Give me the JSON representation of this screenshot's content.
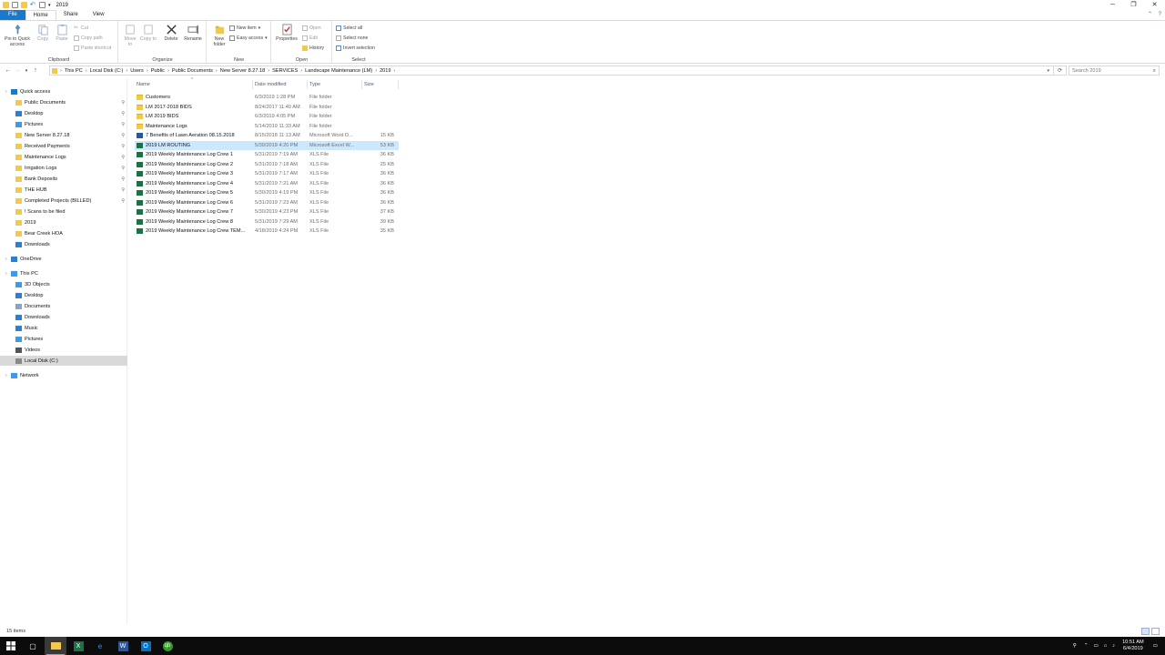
{
  "window": {
    "title": "2019"
  },
  "ribbon": {
    "tabs": [
      {
        "label": "File"
      },
      {
        "label": "Home"
      },
      {
        "label": "Share"
      },
      {
        "label": "View"
      }
    ],
    "clipboard": {
      "label": "Clipboard",
      "pin": "Pin to Quick access",
      "copy": "Copy",
      "paste": "Paste",
      "cut": "Cut",
      "copy_path": "Copy path",
      "paste_shortcut": "Paste shortcut"
    },
    "organize": {
      "label": "Organize",
      "move_to": "Move to",
      "copy_to": "Copy to",
      "delete": "Delete",
      "rename": "Rename"
    },
    "new": {
      "label": "New",
      "new_folder": "New folder",
      "new_item": "New item",
      "easy_access": "Easy access"
    },
    "open": {
      "label": "Open",
      "properties": "Properties",
      "open": "Open",
      "edit": "Edit",
      "history": "History"
    },
    "select": {
      "label": "Select",
      "select_all": "Select all",
      "select_none": "Select none",
      "invert": "Invert selection"
    }
  },
  "address": {
    "crumbs": [
      "This PC",
      "Local Disk (C:)",
      "Users",
      "Public",
      "Public Documents",
      "New Server 8.27.18",
      "SERVICES",
      "Landscape Maintenance (LM)",
      "2019"
    ],
    "search_placeholder": "Search 2019"
  },
  "nav": {
    "quick_access": {
      "label": "Quick access",
      "items": [
        {
          "label": "Public Documents",
          "pinned": true
        },
        {
          "label": "Desktop",
          "pinned": true
        },
        {
          "label": "Pictures",
          "pinned": true
        },
        {
          "label": "New Server 8.27.18",
          "pinned": true
        },
        {
          "label": "Received Payments",
          "pinned": true
        },
        {
          "label": "Maintenance Logs",
          "pinned": true
        },
        {
          "label": "Irrigation Logs",
          "pinned": true
        },
        {
          "label": "Bank Deposits",
          "pinned": true
        },
        {
          "label": "THE HUB",
          "pinned": true
        },
        {
          "label": "Completed Projects (BILLED)",
          "pinned": true
        },
        {
          "label": "! Scans to be filed",
          "pinned": false
        },
        {
          "label": "2019",
          "pinned": false
        },
        {
          "label": "Bear Creek HOA",
          "pinned": false
        },
        {
          "label": "Downloads",
          "pinned": false
        }
      ]
    },
    "onedrive": "OneDrive",
    "this_pc": {
      "label": "This PC",
      "items": [
        {
          "label": "3D Objects"
        },
        {
          "label": "Desktop"
        },
        {
          "label": "Documents"
        },
        {
          "label": "Downloads"
        },
        {
          "label": "Music"
        },
        {
          "label": "Pictures"
        },
        {
          "label": "Videos"
        },
        {
          "label": "Local Disk (C:)"
        }
      ]
    },
    "network": "Network"
  },
  "columns": {
    "name": "Name",
    "date": "Date modified",
    "type": "Type",
    "size": "Size"
  },
  "files": [
    {
      "name": "Customers",
      "date": "6/3/2019 1:28 PM",
      "type": "File folder",
      "size": "",
      "kind": "folder"
    },
    {
      "name": "LM 2017-2018 BIDS",
      "date": "8/24/2017 11:40 AM",
      "type": "File folder",
      "size": "",
      "kind": "folder"
    },
    {
      "name": "LM 2019 BIDS",
      "date": "6/3/2019 4:05 PM",
      "type": "File folder",
      "size": "",
      "kind": "folder"
    },
    {
      "name": "Maintenance Logs",
      "date": "5/14/2019 11:33 AM",
      "type": "File folder",
      "size": "",
      "kind": "folder"
    },
    {
      "name": "7 Benefits of Lawn Aeration 08.15.2018",
      "date": "8/15/2018 11:13 AM",
      "type": "Microsoft Word D...",
      "size": "15 KB",
      "kind": "word"
    },
    {
      "name": "2019 LM ROUTING",
      "date": "5/30/2019 4:20 PM",
      "type": "Microsoft Excel W...",
      "size": "53 KB",
      "kind": "xls"
    },
    {
      "name": "2019 Weekly Maintenance Log Crew 1",
      "date": "5/31/2019 7:19 AM",
      "type": "XLS File",
      "size": "36 KB",
      "kind": "xls"
    },
    {
      "name": "2019 Weekly Maintenance Log Crew 2",
      "date": "5/31/2019 7:18 AM",
      "type": "XLS File",
      "size": "25 KB",
      "kind": "xls"
    },
    {
      "name": "2019 Weekly Maintenance Log Crew 3",
      "date": "5/31/2019 7:17 AM",
      "type": "XLS File",
      "size": "36 KB",
      "kind": "xls"
    },
    {
      "name": "2019 Weekly Maintenance Log Crew 4",
      "date": "5/31/2019 7:21 AM",
      "type": "XLS File",
      "size": "36 KB",
      "kind": "xls"
    },
    {
      "name": "2019 Weekly Maintenance Log Crew 5",
      "date": "5/30/2019 4:19 PM",
      "type": "XLS File",
      "size": "36 KB",
      "kind": "xls"
    },
    {
      "name": "2019 Weekly Maintenance Log Crew 6",
      "date": "5/31/2019 7:23 AM",
      "type": "XLS File",
      "size": "36 KB",
      "kind": "xls"
    },
    {
      "name": "2019 Weekly Maintenance Log Crew 7",
      "date": "5/30/2019 4:23 PM",
      "type": "XLS File",
      "size": "37 KB",
      "kind": "xls"
    },
    {
      "name": "2019 Weekly Maintenance Log Crew 8",
      "date": "5/31/2019 7:29 AM",
      "type": "XLS File",
      "size": "39 KB",
      "kind": "xls"
    },
    {
      "name": "2019 Weekly Maintenance Log Crew TEM...",
      "date": "4/18/2019 4:24 PM",
      "type": "XLS File",
      "size": "35 KB",
      "kind": "xls"
    }
  ],
  "selected_file": "2019 LM ROUTING",
  "status": {
    "count": "15 items"
  },
  "taskbar": {
    "time": "10:51 AM",
    "date": "6/4/2019"
  },
  "colors": {
    "file_tab": "#1979ca",
    "selection": "#cce8ff",
    "folder": "#f2c94c",
    "excel": "#1e7145",
    "word": "#2b579a"
  }
}
